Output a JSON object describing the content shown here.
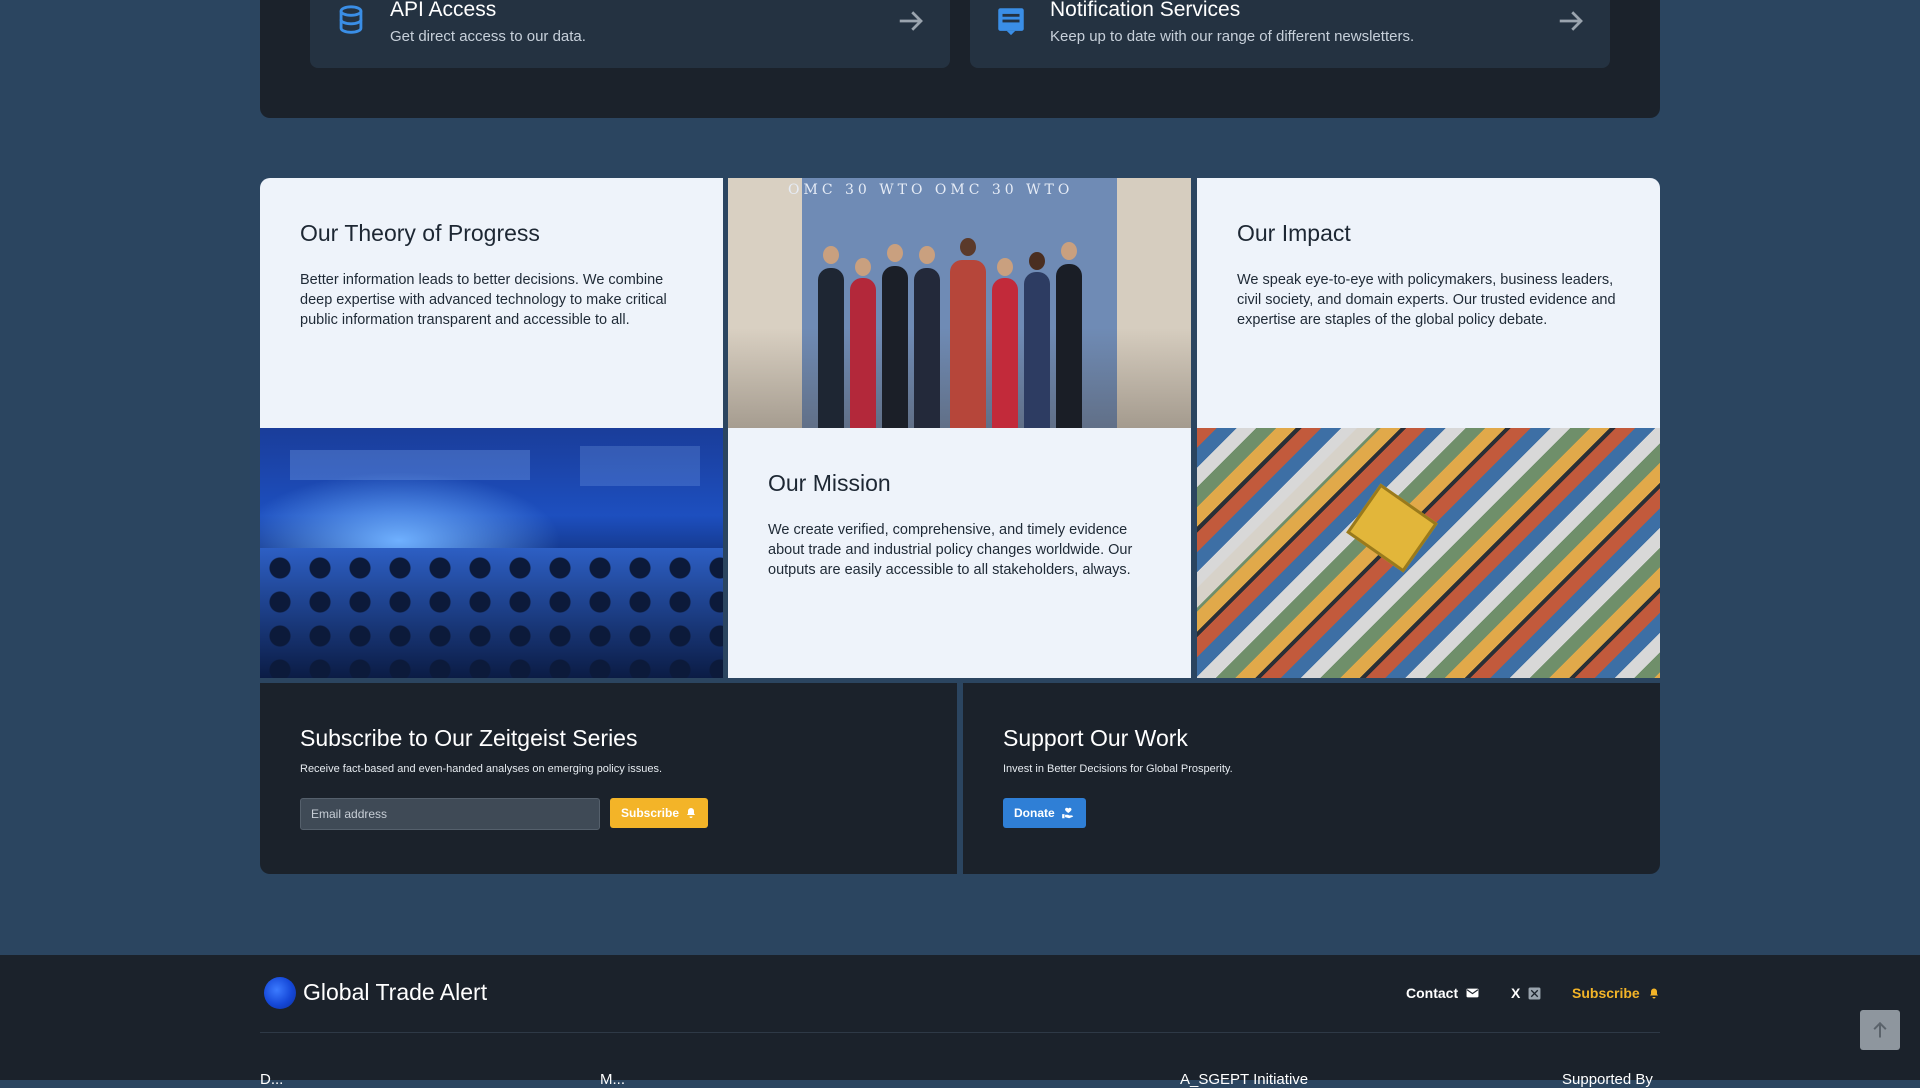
{
  "services": [
    {
      "title": "API Access",
      "description": "Get direct access to our data.",
      "icon": "database-icon"
    },
    {
      "title": "Notification Services",
      "description": "Keep up to date with our range of different newsletters.",
      "icon": "newsletter-icon"
    }
  ],
  "tiles": {
    "theory": {
      "title": "Our Theory of Progress",
      "body": "Better information leads to better decisions. We combine deep expertise with advanced technology to make critical public information transparent and accessible to all."
    },
    "impact": {
      "title": "Our Impact",
      "body": "We speak eye-to-eye with policymakers, business leaders, civil society, and domain experts. Our trusted evidence and expertise are staples of the global policy debate."
    },
    "mission": {
      "title": "Our Mission",
      "body": "We create verified, comprehensive, and timely evidence about trade and industrial policy changes worldwide. Our outputs are easily accessible to all stakeholders, always."
    },
    "wto_banner": "OMC 30 WTO OMC 30 WTO"
  },
  "subscribe_panel": {
    "title": "Subscribe to Our Zeitgeist Series",
    "description": "Receive fact-based and even-handed analyses on emerging policy issues.",
    "email_placeholder": "Email address",
    "button_label": "Subscribe"
  },
  "support_panel": {
    "title": "Support Our Work",
    "description": "Invest in Better Decisions for Global Prosperity.",
    "button_label": "Donate"
  },
  "footer": {
    "logo_text": "Global Trade Alert",
    "links": {
      "contact": "Contact",
      "x": "X",
      "subscribe": "Subscribe"
    },
    "columns": [
      "D...",
      "M...",
      "A_SGEPT Initiative",
      "Supported By"
    ]
  },
  "colors": {
    "background": "#2b4560",
    "panel": "#1b222b",
    "accent_yellow": "#f3b428",
    "accent_blue": "#2f7fd6"
  }
}
